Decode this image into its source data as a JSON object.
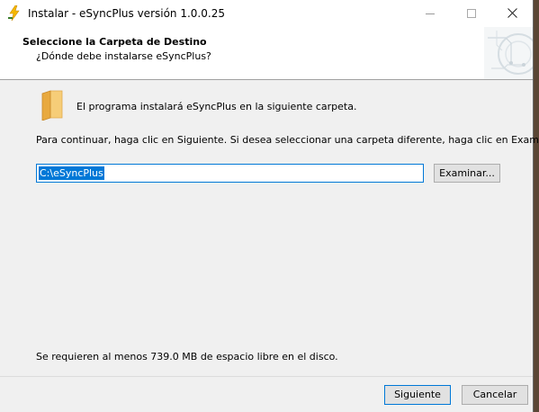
{
  "window": {
    "title": "Instalar - eSyncPlus versión 1.0.0.25",
    "app_icon": "lightning-bolt-icon",
    "controls": [
      "minimize",
      "maximize",
      "close"
    ]
  },
  "header": {
    "title": "Seleccione la Carpeta de Destino",
    "subtitle": "¿Dónde debe instalarse eSyncPlus?"
  },
  "body": {
    "folder_icon": "folder-icon",
    "intro_text": "El programa instalará eSyncPlus en la siguiente carpeta.",
    "instructions": "Para continuar, haga clic en Siguiente. Si desea seleccionar una carpeta diferente, haga clic en Examinar.",
    "install_path": "C:\\eSyncPlus",
    "browse_label": "Examinar...",
    "disk_space_text": "Se requieren al menos 739.0 MB de espacio libre en el disco."
  },
  "footer": {
    "next_label": "Siguiente",
    "cancel_label": "Cancelar"
  },
  "colors": {
    "accent": "#0078d7",
    "window_bg": "#f0f0f0",
    "folder": "#f2c46d"
  }
}
